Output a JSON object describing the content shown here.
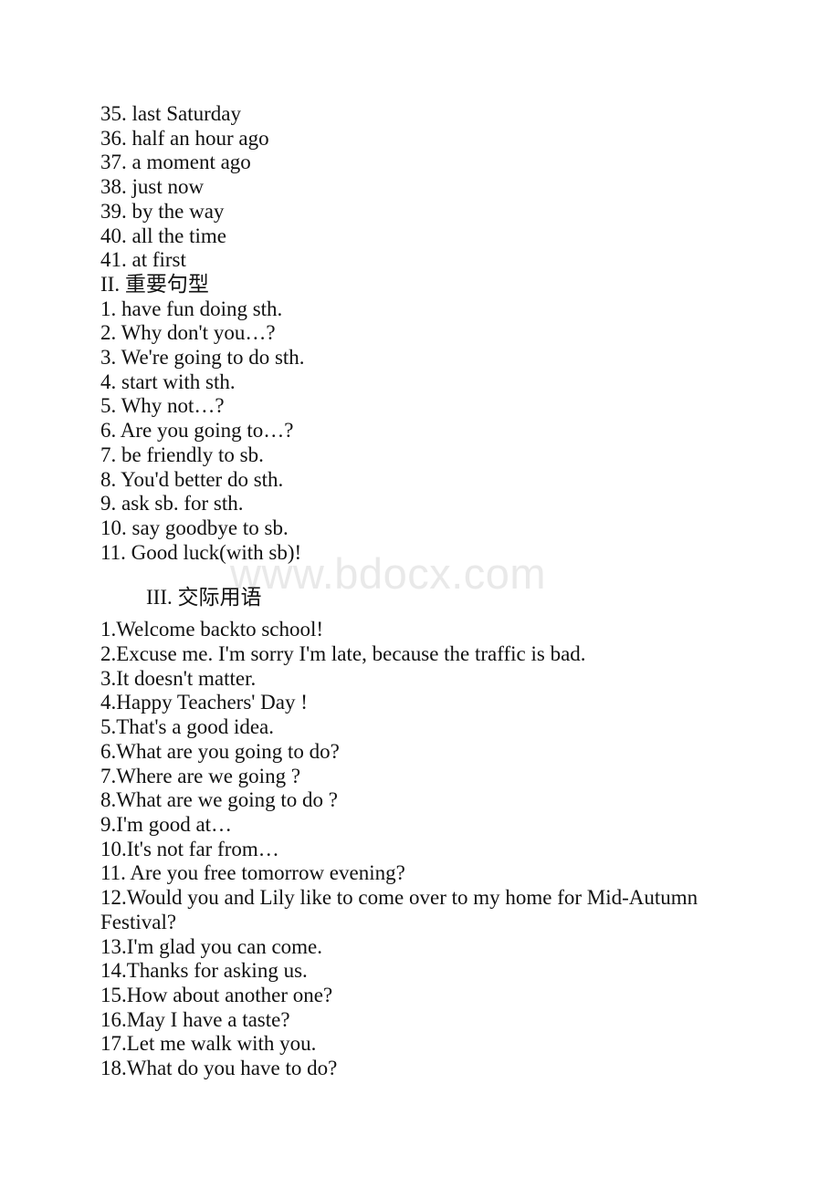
{
  "document": {
    "watermark": "www.bdocx.com",
    "sections": [
      {
        "id": "phrases-continued",
        "heading": null,
        "items": [
          "35. last Saturday",
          "36. half an hour ago",
          "37. a moment ago",
          "38. just now",
          "39. by the way",
          "40. all the time",
          "41. at first"
        ]
      },
      {
        "id": "sentence-patterns",
        "heading": "II. 重要句型",
        "items": [
          "1. have fun doing sth.",
          "2. Why don't you…?",
          "3. We're going to do sth.",
          "4. start with sth.",
          "5. Why not…?",
          "6. Are you going to…?",
          "7. be friendly to sb.",
          "8. You'd better do sth.",
          "9. ask sb. for sth.",
          "10. say goodbye to sb.",
          "11. Good luck(with sb)!"
        ]
      },
      {
        "id": "communicative-expressions",
        "heading": "III. 交际用语",
        "items": [
          "1.Welcome backto school!",
          "2.Excuse me. I'm sorry I'm late, because the traffic is bad.",
          "3.It doesn't matter.",
          "4.Happy Teachers' Day !",
          "5.That's a good idea.",
          "6.What are you going to do?",
          "7.Where are we going ?",
          "8.What are we going to do ?",
          "9.I'm good at…",
          "10.It's not far from…",
          "11. Are you free tomorrow evening?",
          "12.Would you and Lily like to come over to my home for Mid-Autumn",
          "Festival?",
          "13.I'm glad you can come.",
          "14.Thanks for asking us.",
          "15.How about another one?",
          "16.May I have a taste?",
          "17.Let me walk with you.",
          "18.What do you have to do?"
        ]
      }
    ]
  }
}
